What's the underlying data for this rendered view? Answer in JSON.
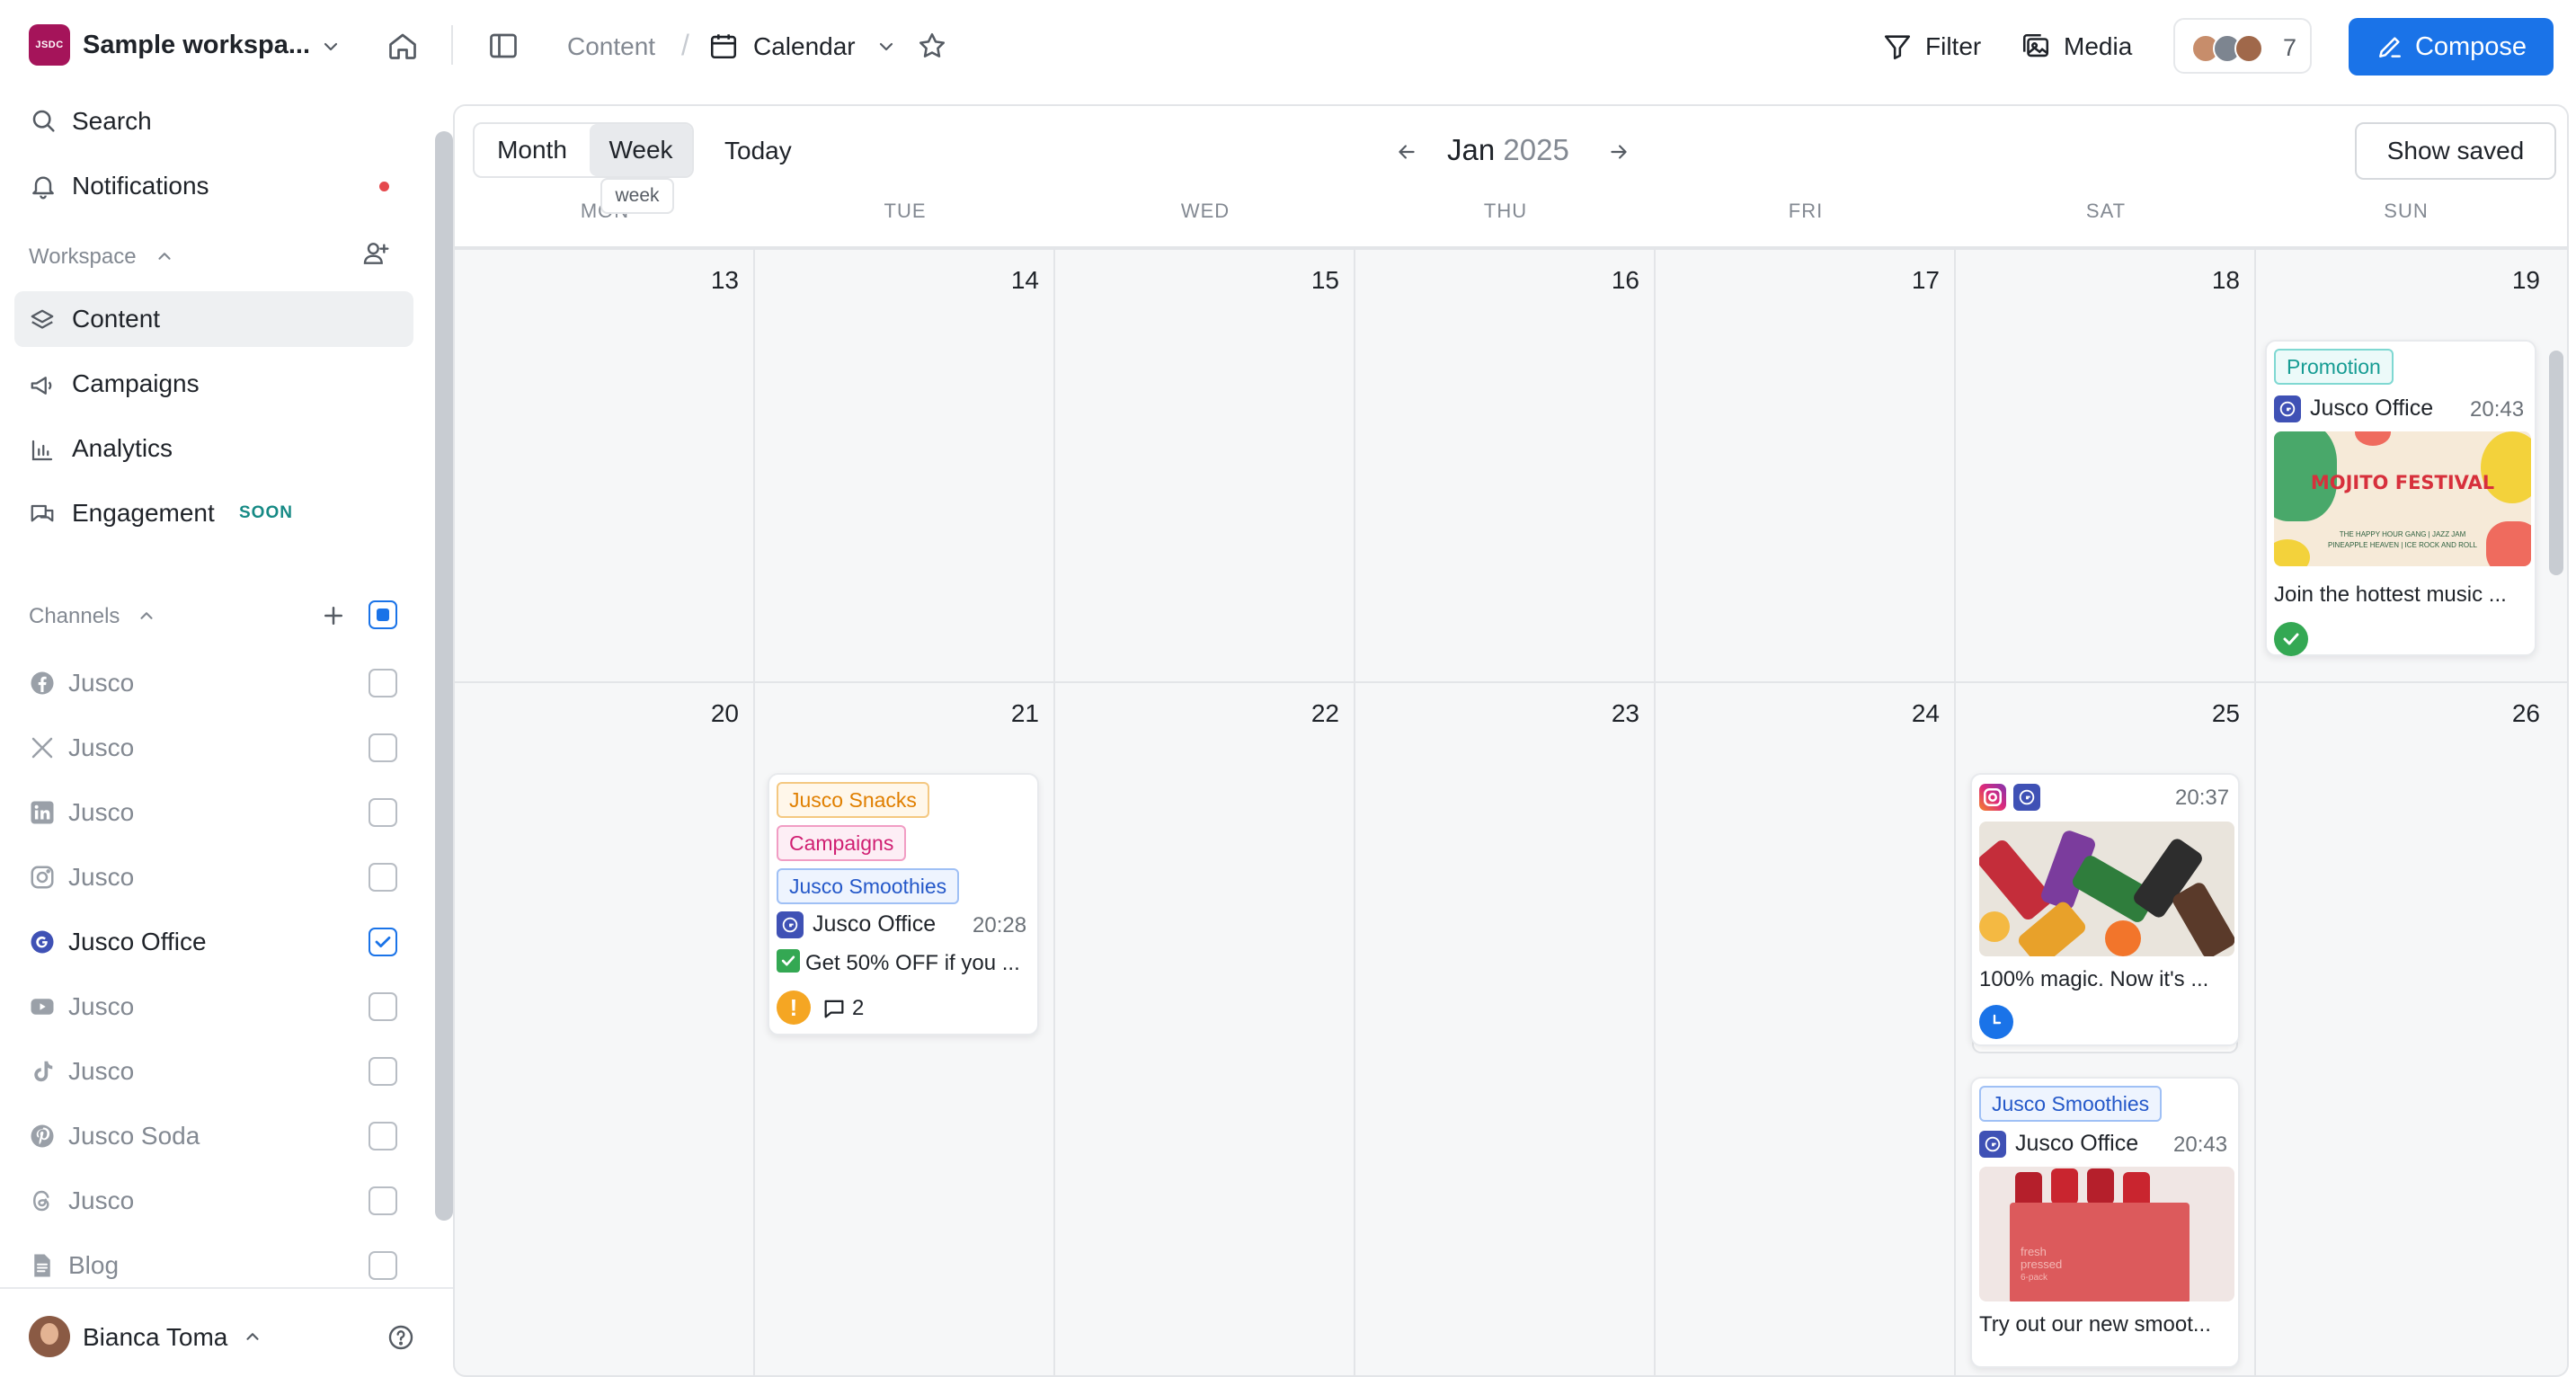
{
  "topbar": {
    "workspace_logo": "JSDC",
    "workspace_name": "Sample workspa...",
    "breadcrumb_content": "Content",
    "breadcrumb_sep": "/",
    "breadcrumb_calendar": "Calendar",
    "filter_label": "Filter",
    "media_label": "Media",
    "members_count": "7",
    "compose_label": "Compose"
  },
  "sidebar": {
    "search_label": "Search",
    "notifications_label": "Notifications",
    "workspace_section": "Workspace",
    "nav": [
      {
        "label": "Content",
        "icon": "layers-icon",
        "active": true
      },
      {
        "label": "Campaigns",
        "icon": "megaphone-icon"
      },
      {
        "label": "Analytics",
        "icon": "bar-chart-icon"
      },
      {
        "label": "Engagement",
        "icon": "chat-icon",
        "badge": "SOON"
      }
    ],
    "channels_section": "Channels",
    "channels": [
      {
        "label": "Jusco",
        "icon": "facebook-icon",
        "checked": false
      },
      {
        "label": "Jusco",
        "icon": "x-icon",
        "checked": false
      },
      {
        "label": "Jusco",
        "icon": "linkedin-icon",
        "checked": false
      },
      {
        "label": "Jusco",
        "icon": "instagram-icon",
        "checked": false
      },
      {
        "label": "Jusco Office",
        "icon": "google-business-icon",
        "checked": true
      },
      {
        "label": "Jusco",
        "icon": "youtube-icon",
        "checked": false
      },
      {
        "label": "Jusco",
        "icon": "tiktok-icon",
        "checked": false
      },
      {
        "label": "Jusco Soda",
        "icon": "pinterest-icon",
        "checked": false
      },
      {
        "label": "Jusco",
        "icon": "threads-icon",
        "checked": false
      },
      {
        "label": "Blog",
        "icon": "document-icon",
        "checked": false
      }
    ],
    "user_name": "Bianca Toma"
  },
  "calendar": {
    "view_month": "Month",
    "view_week": "Week",
    "tooltip": "week",
    "today_label": "Today",
    "month": "Jan",
    "year": "2025",
    "show_saved": "Show saved",
    "weekdays": [
      "MON",
      "TUE",
      "WED",
      "THU",
      "FRI",
      "SAT",
      "SUN"
    ],
    "week1": [
      "13",
      "14",
      "15",
      "16",
      "17",
      "18",
      "19"
    ],
    "week2": [
      "20",
      "21",
      "22",
      "23",
      "24",
      "25",
      "26"
    ]
  },
  "posts": {
    "p19": {
      "tag": "Promotion",
      "account": "Jusco Office",
      "time": "20:43",
      "image_title": "MOJITO FESTIVAL",
      "image_sub1": "THE HAPPY HOUR GANG | JAZZ JAM",
      "image_sub2": "PINEAPPLE HEAVEN | ICE ROCK AND ROLL",
      "text": "Join the hottest music ..."
    },
    "p21": {
      "tags": [
        "Jusco Snacks",
        "Campaigns",
        "Jusco Smoothies"
      ],
      "account": "Jusco Office",
      "time": "20:28",
      "text": "Get 50% OFF if you ...",
      "comments": "2"
    },
    "p25a": {
      "time": "20:37",
      "text": "100% magic. Now it's ..."
    },
    "p25b": {
      "tag": "Jusco Smoothies",
      "account": "Jusco Office",
      "time": "20:43",
      "image_label1": "fresh",
      "image_label2": "pressed",
      "image_label3": "6-pack",
      "text": "Try out our new smoot..."
    }
  },
  "colors": {
    "accent": "#1a73e8",
    "brand": "#a5145a",
    "notification_dot": "#e5484d",
    "success": "#34a853",
    "warning": "#f5a623"
  }
}
